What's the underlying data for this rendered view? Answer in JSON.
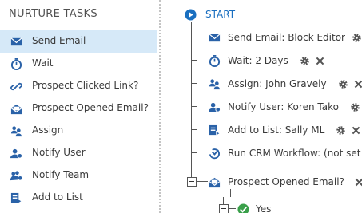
{
  "left_panel": {
    "title": "NURTURE TASKS",
    "tasks": [
      {
        "label": "Send Email",
        "icon": "envelope-icon",
        "selected": true
      },
      {
        "label": "Wait",
        "icon": "stopwatch-icon"
      },
      {
        "label": "Prospect Clicked Link?",
        "icon": "link-icon"
      },
      {
        "label": "Prospect Opened Email?",
        "icon": "open-envelope-icon"
      },
      {
        "label": "Assign",
        "icon": "assign-users-icon"
      },
      {
        "label": "Notify User",
        "icon": "notify-user-icon"
      },
      {
        "label": "Notify Team",
        "icon": "notify-team-icon"
      },
      {
        "label": "Add to List",
        "icon": "add-to-list-icon"
      }
    ]
  },
  "flow": {
    "start_label": "START",
    "steps": [
      {
        "label": "Send Email: Block Editor",
        "icon": "envelope-icon"
      },
      {
        "label": "Wait: 2 Days",
        "icon": "stopwatch-icon"
      },
      {
        "label": "Assign: John Gravely",
        "icon": "assign-users-icon"
      },
      {
        "label": "Notify User: Koren Tako",
        "icon": "notify-user-icon"
      },
      {
        "label": "Add to List: Sally ML",
        "icon": "add-to-list-icon"
      },
      {
        "label": "Run CRM Workflow: (not set",
        "icon": "crm-workflow-icon"
      },
      {
        "label": "Prospect Opened Email?",
        "icon": "open-envelope-icon"
      }
    ],
    "branch_yes_label": "Yes"
  },
  "colors": {
    "accent": "#1a6fc0",
    "icon_blue": "#2a62a8",
    "selected_bg": "#d6e9f8",
    "gear": "#555555",
    "yes_green": "#3aa04a"
  }
}
